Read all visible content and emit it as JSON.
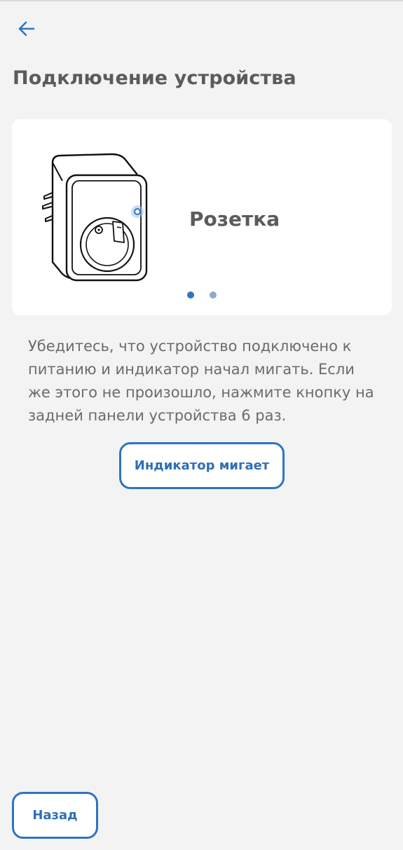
{
  "header": {
    "back_icon": "arrow-left-icon",
    "title": "Подключение устройства"
  },
  "device_card": {
    "image_icon": "smart-plug-illustration",
    "device_name": "Розетка",
    "carousel": {
      "active_index": 0,
      "dots": [
        "dot-1",
        "dot-2"
      ]
    }
  },
  "instructions": {
    "text": "Убедитесь, что устройство подключено к питанию и индикатор начал мигать. Если же этого не произошло, нажмите кнопку на задней панели устройства 6 раз."
  },
  "actions": {
    "indicator_blinking_label": "Индикатор мигает",
    "back_label": "Назад"
  },
  "colors": {
    "accent": "#2f74c0",
    "background": "#f3f3f4",
    "card": "#ffffff",
    "text": "#5b5b5b"
  }
}
